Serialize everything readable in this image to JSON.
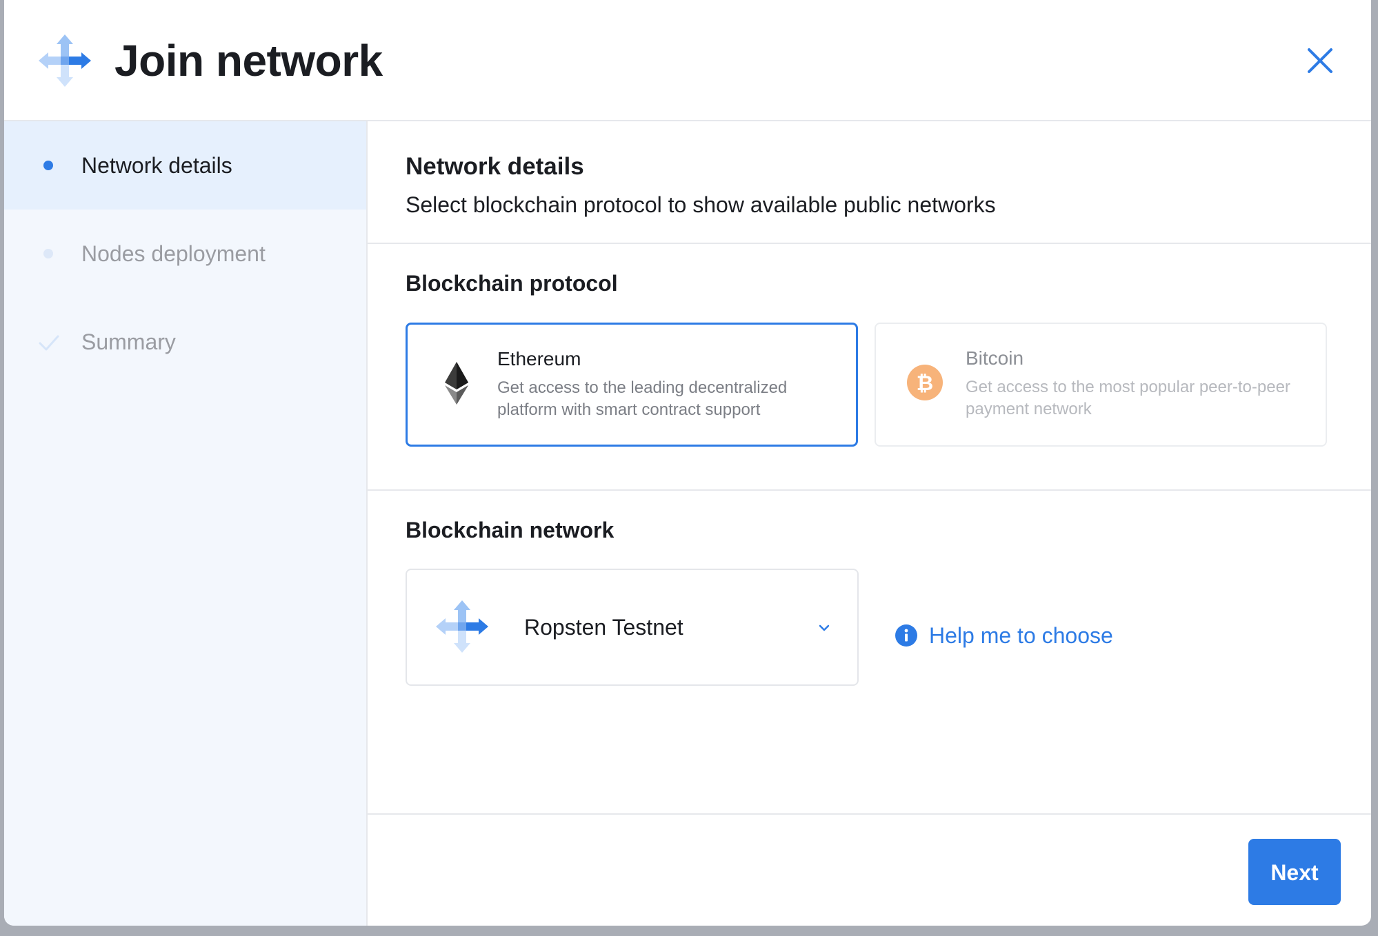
{
  "header": {
    "title": "Join network",
    "logo_icon": "network-arrows-icon",
    "close_icon": "close-icon"
  },
  "sidebar": {
    "steps": [
      {
        "label": "Network details",
        "state": "active",
        "marker": "dot"
      },
      {
        "label": "Nodes deployment",
        "state": "pending",
        "marker": "dot"
      },
      {
        "label": "Summary",
        "state": "pending",
        "marker": "check"
      }
    ]
  },
  "main": {
    "title": "Network details",
    "subtitle": "Select blockchain protocol to show available public networks",
    "protocol": {
      "heading": "Blockchain protocol",
      "options": [
        {
          "name": "Ethereum",
          "description": "Get access to the leading decentralized platform with smart contract support",
          "icon": "ethereum-icon",
          "selected": true
        },
        {
          "name": "Bitcoin",
          "description": "Get access to the most popular peer-to-peer payment network",
          "icon": "bitcoin-icon",
          "selected": false
        }
      ]
    },
    "network": {
      "heading": "Blockchain network",
      "selected_value": "Ropsten Testnet",
      "help_link": "Help me to choose"
    },
    "next_label": "Next"
  },
  "colors": {
    "accent": "#2d7be5",
    "sidebar_bg": "#f3f7fd",
    "active_step_bg": "#e6f0fd",
    "bitcoin": "#f7b37a"
  }
}
